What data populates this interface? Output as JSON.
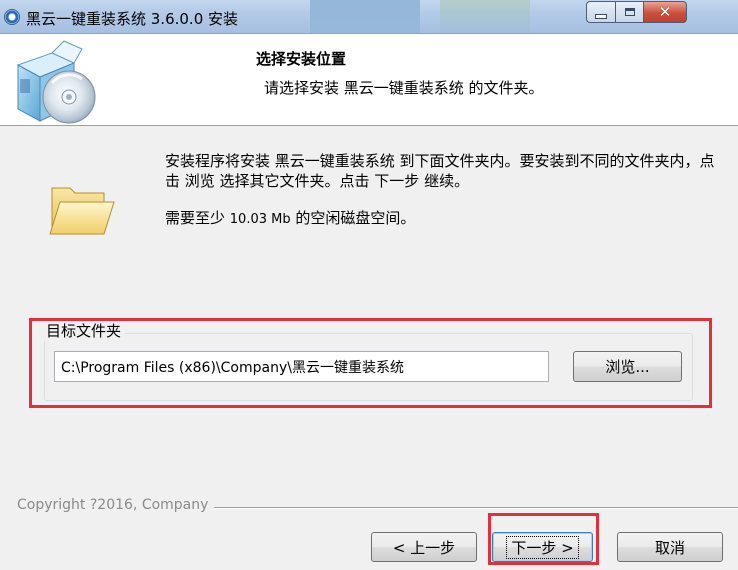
{
  "window": {
    "title": "黑云一键重装系统 3.6.0.0 安装",
    "minimize_glyph": "",
    "maximize_glyph": "",
    "close_glyph": "✕"
  },
  "header": {
    "title": "选择安装位置",
    "subtitle": "请选择安装 黑云一键重装系统 的文件夹。"
  },
  "body": {
    "intro": "安装程序将安装 黑云一键重装系统 到下面文件夹内。要安装到不同的文件夹内，点击 浏览 选择其它文件夹。点击 下一步 继续。",
    "space_prefix": "需要至少 ",
    "space_value": "10.03 Mb",
    "space_suffix": " 的空闲磁盘空间。"
  },
  "target": {
    "group_label": "目标文件夹",
    "path_value": "C:\\Program Files (x86)\\Company\\黑云一键重装系统",
    "browse_label": "浏览..."
  },
  "footer": {
    "copyright": "Copyright ?2016, Company",
    "back_label": "< 上一步",
    "next_label": "下一步 >",
    "cancel_label": "取消"
  },
  "colors": {
    "highlight": "#e0303a",
    "background": "#f0f0f0"
  }
}
